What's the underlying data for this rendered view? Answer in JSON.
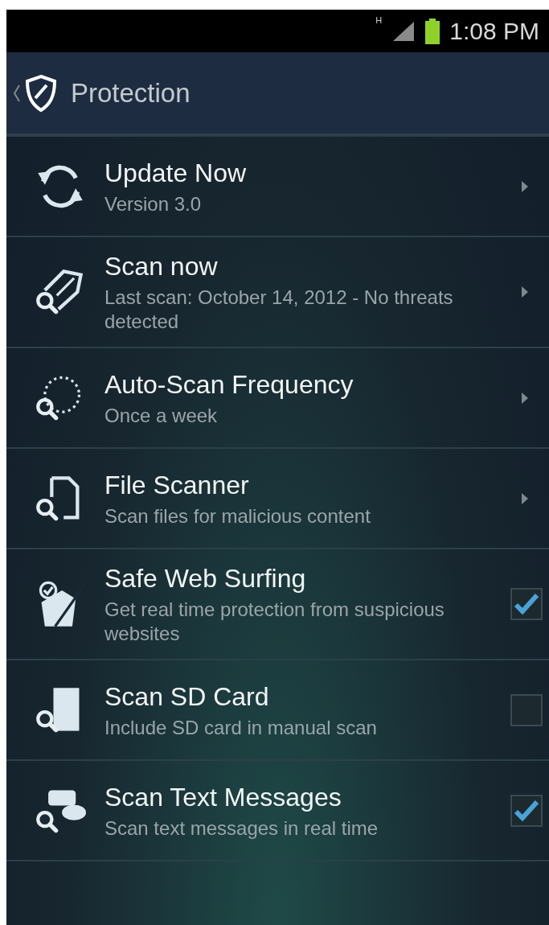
{
  "status_bar": {
    "network": "H",
    "time": "1:08 PM"
  },
  "header": {
    "title": "Protection"
  },
  "items": [
    {
      "kind": "link",
      "title": "Update Now",
      "subtitle": "Version 3.0"
    },
    {
      "kind": "link",
      "title": "Scan now",
      "subtitle": "Last scan: October 14, 2012 - No threats detected"
    },
    {
      "kind": "link",
      "title": "Auto-Scan Frequency",
      "subtitle": "Once a week"
    },
    {
      "kind": "link",
      "title": "File Scanner",
      "subtitle": "Scan files for malicious content"
    },
    {
      "kind": "toggle",
      "title": "Safe Web Surfing",
      "subtitle": "Get real time protection from suspicious websites",
      "checked": true
    },
    {
      "kind": "toggle",
      "title": "Scan SD Card",
      "subtitle": "Include SD card in manual scan",
      "checked": false
    },
    {
      "kind": "toggle",
      "title": "Scan Text Messages",
      "subtitle": "Scan text messages in real time",
      "checked": true
    }
  ]
}
